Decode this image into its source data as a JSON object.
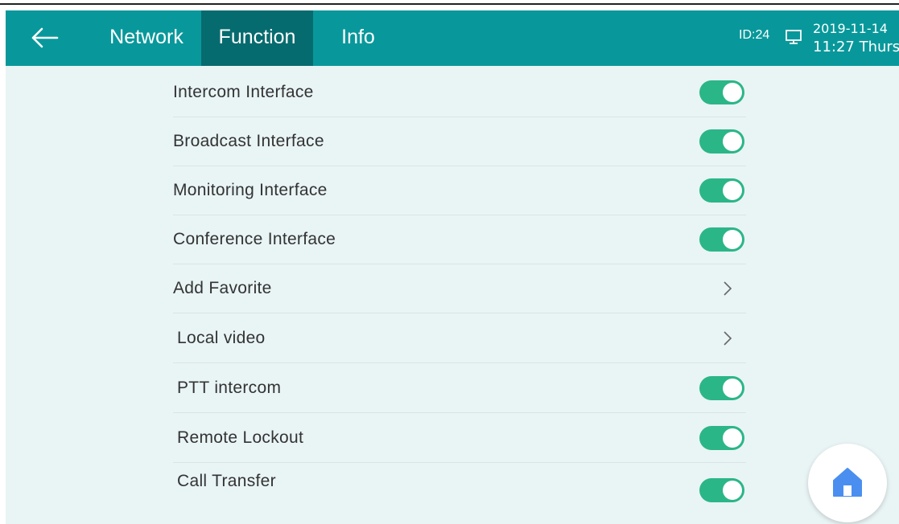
{
  "header": {
    "tabs": [
      {
        "label": "Network",
        "active": false
      },
      {
        "label": "Function",
        "active": true
      },
      {
        "label": "Info",
        "active": false
      }
    ],
    "device_id": "ID:24",
    "date": "2019-11-14",
    "time": "11:27 Thurs"
  },
  "settings": [
    {
      "label": "Intercom Interface",
      "control": "toggle",
      "on": true
    },
    {
      "label": "Broadcast Interface",
      "control": "toggle",
      "on": true
    },
    {
      "label": "Monitoring Interface",
      "control": "toggle",
      "on": true
    },
    {
      "label": "Conference Interface",
      "control": "toggle",
      "on": true
    },
    {
      "label": "Add Favorite",
      "control": "chevron"
    },
    {
      "label": "Local video",
      "control": "chevron"
    },
    {
      "label": "PTT intercom",
      "control": "toggle",
      "on": true
    },
    {
      "label": "Remote Lockout",
      "control": "toggle",
      "on": true
    },
    {
      "label": "Call Transfer",
      "control": "toggle",
      "on": true
    }
  ],
  "icons": {
    "back": "back-arrow-icon",
    "screen": "monitor-icon",
    "home": "home-icon",
    "chevron": "chevron-right-icon"
  },
  "colors": {
    "header": "#08989b",
    "active_tab": "#066b6e",
    "background": "#e9f4f5",
    "toggle_on": "#2bb687",
    "home_icon": "#4a8ff0"
  }
}
